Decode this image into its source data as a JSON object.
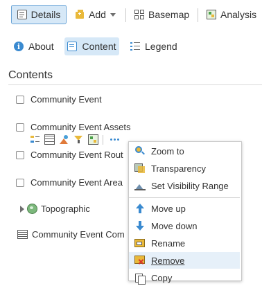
{
  "toolbar": {
    "details_label": "Details",
    "add_label": "Add",
    "basemap_label": "Basemap",
    "analysis_label": "Analysis"
  },
  "tabs": [
    {
      "label": "About",
      "icon": "info-icon"
    },
    {
      "label": "Content",
      "icon": "content-list-icon",
      "selected": true
    },
    {
      "label": "Legend",
      "icon": "legend-list-icon"
    }
  ],
  "heading": "Contents",
  "layers": [
    {
      "label": "Community Event",
      "checked": false
    },
    {
      "label": "Community Event Assets",
      "checked": false
    },
    {
      "label": "Community Event Rout",
      "checked": false
    },
    {
      "label": "Community Event Area",
      "checked": false
    },
    {
      "label": "Topographic",
      "type": "basemap"
    },
    {
      "label": "Community Event Com",
      "type": "table"
    }
  ],
  "layer_tools": [
    "show-legend-icon",
    "show-table-icon",
    "change-style-icon",
    "filter-icon",
    "analysis-icon",
    "more-options-icon"
  ],
  "context_menu": {
    "items": [
      {
        "label": "Zoom to",
        "icon": "zoom-to-icon"
      },
      {
        "label": "Transparency",
        "icon": "transparency-icon"
      },
      {
        "label": "Set Visibility Range",
        "icon": "visibility-range-icon"
      },
      {
        "label": "Move up",
        "icon": "arrow-up-icon"
      },
      {
        "label": "Move down",
        "icon": "arrow-down-icon"
      },
      {
        "label": "Rename",
        "icon": "rename-icon"
      },
      {
        "label": "Remove",
        "icon": "remove-icon",
        "highlighted": true
      },
      {
        "label": "Copy",
        "icon": "copy-icon"
      }
    ]
  },
  "colors": {
    "accent": "#1f7ac1",
    "selected_bg": "#d6e8f7",
    "menu_highlight": "#e6f0f9"
  }
}
